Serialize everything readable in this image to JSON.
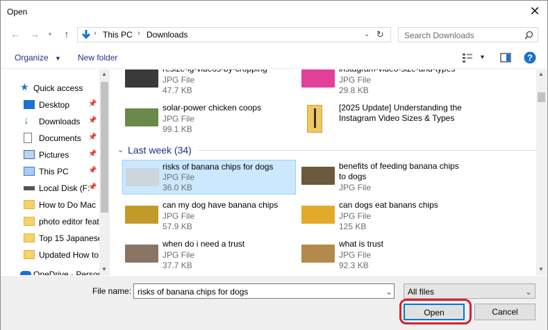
{
  "window": {
    "title": "Open"
  },
  "nav": {
    "path": [
      "This PC",
      "Downloads"
    ],
    "search_placeholder": "Search Downloads"
  },
  "toolbar": {
    "organize": "Organize",
    "new_folder": "New folder"
  },
  "sidebar": {
    "items": [
      {
        "label": "Quick access",
        "icon": "star-icon"
      },
      {
        "label": "Desktop",
        "icon": "desktop-icon",
        "pinned": true
      },
      {
        "label": "Downloads",
        "icon": "download-icon",
        "pinned": true
      },
      {
        "label": "Documents",
        "icon": "document-icon",
        "pinned": true
      },
      {
        "label": "Pictures",
        "icon": "pictures-icon",
        "pinned": true
      },
      {
        "label": "This PC",
        "icon": "computer-icon",
        "pinned": true
      },
      {
        "label": "Local Disk (F:",
        "icon": "drive-icon",
        "pinned": true
      },
      {
        "label": "How to Do Mac",
        "icon": "folder-icon"
      },
      {
        "label": "photo editor feat",
        "icon": "folder-icon"
      },
      {
        "label": "Top 15 Japanese",
        "icon": "folder-icon"
      },
      {
        "label": "Updated How to",
        "icon": "folder-icon"
      },
      {
        "label": "OneDrive - Person",
        "icon": "cloud-icon"
      }
    ]
  },
  "files_top": [
    {
      "name": "resize-ig-videos-by-cropping",
      "type": "JPG File",
      "size": "47.7 KB",
      "thumb": "#3a3a3a"
    },
    {
      "name": "instagram-video-size-and-types",
      "type": "JPG File",
      "size": "29.8 KB",
      "thumb": "#e13f9a"
    },
    {
      "name": "solar-power chicken coops",
      "type": "JPG File",
      "size": "99.1 KB",
      "thumb": "#6b8a4a"
    },
    {
      "name": "[2025 Update] Understanding the Instagram Video Sizes & Types",
      "type": "",
      "size": "",
      "thumb": "#e8c675"
    }
  ],
  "group": {
    "label": "Last week (34)"
  },
  "files_week": [
    {
      "name": "risks of banana chips for dogs",
      "type": "JPG File",
      "size": "36.0 KB",
      "thumb": "#cdd6dc",
      "selected": true
    },
    {
      "name": "benefits of feeding banana chips to dogs",
      "type": "JPG File",
      "size": "",
      "thumb": "#6c5a3e"
    },
    {
      "name": "can my dog have banana chips",
      "type": "JPG File",
      "size": "57.9 KB",
      "thumb": "#c29a2c"
    },
    {
      "name": "can dogs eat banans chips",
      "type": "JPG File",
      "size": "125 KB",
      "thumb": "#e3a92a"
    },
    {
      "name": "when do i need a trust",
      "type": "JPG File",
      "size": "37.7 KB",
      "thumb": "#8a7565"
    },
    {
      "name": "what is trust",
      "type": "JPG File",
      "size": "92.3 KB",
      "thumb": "#b38a4c"
    }
  ],
  "bottom": {
    "file_name_label": "File name:",
    "file_name_value": "risks of banana chips for dogs",
    "filter": "All files",
    "open": "Open",
    "cancel": "Cancel"
  }
}
